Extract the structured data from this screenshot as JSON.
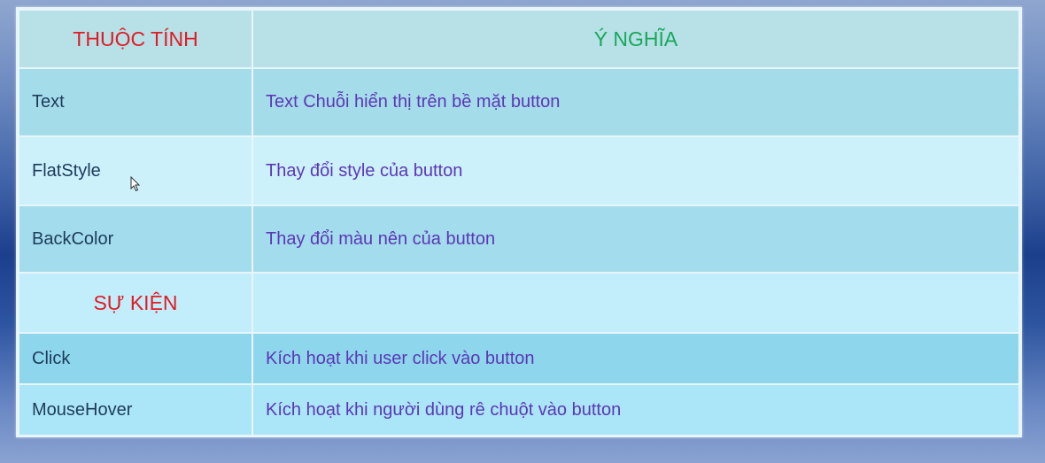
{
  "table": {
    "headers": {
      "property": "THUỘC TÍNH",
      "meaning": "Ý NGHĨA"
    },
    "properties": [
      {
        "name": "Text",
        "meaning": "Text Chuỗi hiển thị trên bề mặt button"
      },
      {
        "name": "FlatStyle",
        "meaning": "Thay đổi style của button"
      },
      {
        "name": "BackColor",
        "meaning": "Thay đổi màu nên của button"
      }
    ],
    "events_header": "SỰ KIỆN",
    "events": [
      {
        "name": "Click",
        "meaning": "Kích hoạt khi user click vào button"
      },
      {
        "name": "MouseHover",
        "meaning": "Kích hoạt khi người dùng rê chuột vào button"
      }
    ]
  },
  "colors": {
    "header_red": "#e01b24",
    "header_green": "#19a85a",
    "description_purple": "#5b37b6"
  },
  "icons": {
    "cursor": "mouse-pointer-icon"
  }
}
